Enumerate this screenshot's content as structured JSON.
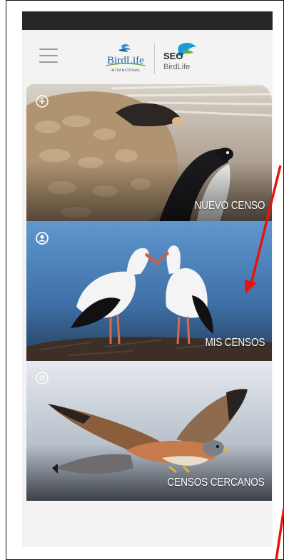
{
  "header": {
    "menu_icon": "hamburger-menu-icon",
    "logos": [
      {
        "name": "BirdLife",
        "subtitle": "INTERNATIONAL"
      },
      {
        "name": "SEO",
        "subtitle": "BirdLife"
      }
    ]
  },
  "cards": [
    {
      "label": "NUEVO CENSO",
      "icon": "plus-circle-icon"
    },
    {
      "label": "MIS CENSOS",
      "icon": "user-circle-icon"
    },
    {
      "label": "CENSOS CERCANOS",
      "icon": "location-target-icon"
    }
  ],
  "colors": {
    "status_bar": "#262626",
    "background": "#f3f3f3",
    "annotation_arrow": "#e8140c",
    "birdlife_blue": "#1b5e9b",
    "birdlife_green": "#6aa84f"
  }
}
